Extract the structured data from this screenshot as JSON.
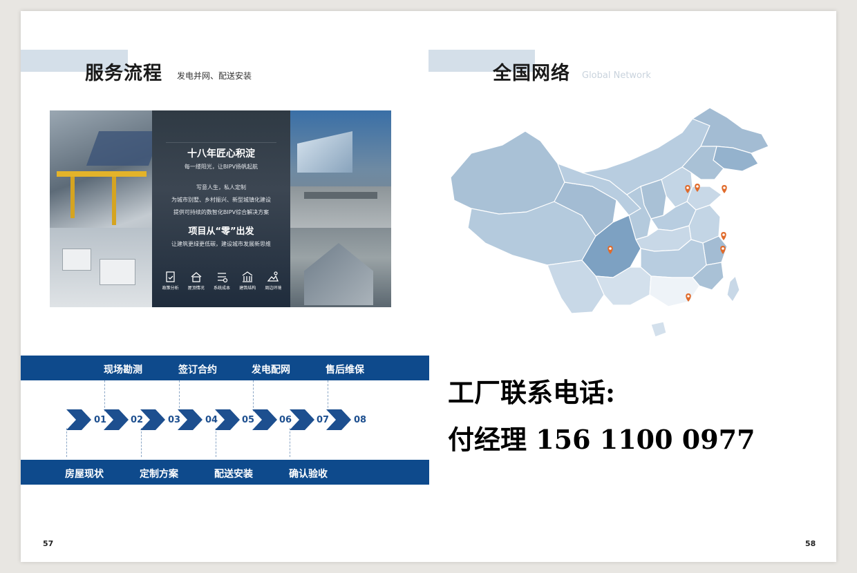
{
  "left_page": {
    "title": "服务流程",
    "subtitle": "发电并网、配送安装",
    "page_number": "57"
  },
  "right_page": {
    "title": "全国网络",
    "subtitle": "Global Network",
    "page_number": "58"
  },
  "collage": {
    "headline": "十八年匠心积淀",
    "tagline": "每一缕阳光，让BIPV扬帆起航",
    "line1": "写意人生，私人定制",
    "line2": "为城市别墅、乡村振兴、新型城镇化建设",
    "line3": "提供可持续的数智化BIPV综合解决方案",
    "headline2": "项目从“零”出发",
    "line4": "让建筑更绿更低碳，建设城市发展新思维",
    "icons": [
      "政策分析",
      "屋顶情况",
      "系统成本",
      "建筑结构",
      "周边环境"
    ]
  },
  "process": {
    "top_labels": [
      "现场勘测",
      "签订合约",
      "发电配网",
      "售后维保"
    ],
    "bottom_labels": [
      "房屋现状",
      "定制方案",
      "配送安装",
      "确认验收"
    ],
    "numbers": [
      "01",
      "02",
      "03",
      "04",
      "05",
      "06",
      "07",
      "08"
    ]
  },
  "contact": {
    "heading": "工厂联系电话:",
    "line": "付经理 156 1100 0977"
  },
  "colors": {
    "process_bar": "#0e4a8c",
    "chevron": "#1d4f8f",
    "title_accent": "#d4dfe9",
    "map_marker": "#e06b2c"
  }
}
